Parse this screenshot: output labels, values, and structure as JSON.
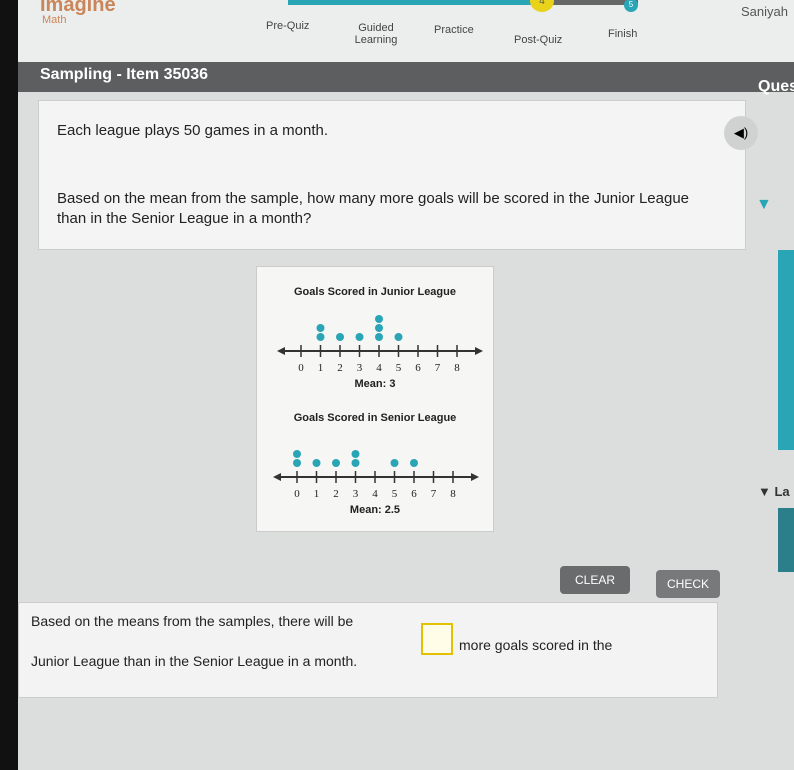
{
  "header": {
    "logo": "Imagine",
    "logo_sub": "Math",
    "user": "Saniyah",
    "steps": [
      {
        "label": "Pre-Quiz",
        "state": "done"
      },
      {
        "label": "Guided Learning",
        "state": "done"
      },
      {
        "label": "Practice",
        "state": "done"
      },
      {
        "label": "Post-Quiz",
        "state": "current",
        "number": "4"
      },
      {
        "label": "Finish",
        "state": "upcoming",
        "number": "5"
      }
    ]
  },
  "title": "Sampling - Item 35036",
  "side_title": "Ques",
  "side_label": "La",
  "question": {
    "line1": "Each league plays 50 games in a month.",
    "line2": "Based on the mean from the sample, how many more goals will be scored in the Junior League than in the Senior League in a month?"
  },
  "colors": {
    "accent": "#2aa5b5",
    "current_step": "#e8d21a",
    "dot": "#2aa5b5"
  },
  "chart_data": [
    {
      "type": "scatter",
      "subtype": "dot-plot",
      "title": "Goals Scored in Junior League",
      "x_ticks": [
        0,
        1,
        2,
        3,
        4,
        5,
        6,
        7,
        8
      ],
      "counts": {
        "1": 2,
        "2": 1,
        "3": 1,
        "4": 3,
        "5": 1
      },
      "caption": "Mean: 3"
    },
    {
      "type": "scatter",
      "subtype": "dot-plot",
      "title": "Goals Scored in Senior League",
      "x_ticks": [
        0,
        1,
        2,
        3,
        4,
        5,
        6,
        7,
        8
      ],
      "counts": {
        "0": 2,
        "1": 1,
        "2": 1,
        "3": 2,
        "5": 1,
        "6": 1
      },
      "caption": "Mean: 2.5"
    }
  ],
  "buttons": {
    "clear": "CLEAR",
    "check": "CHECK"
  },
  "answer": {
    "before": "Based on the means from the samples, there will be",
    "after": "more goals scored in the",
    "line2": "Junior League than in the Senior League in a month.",
    "value": ""
  }
}
